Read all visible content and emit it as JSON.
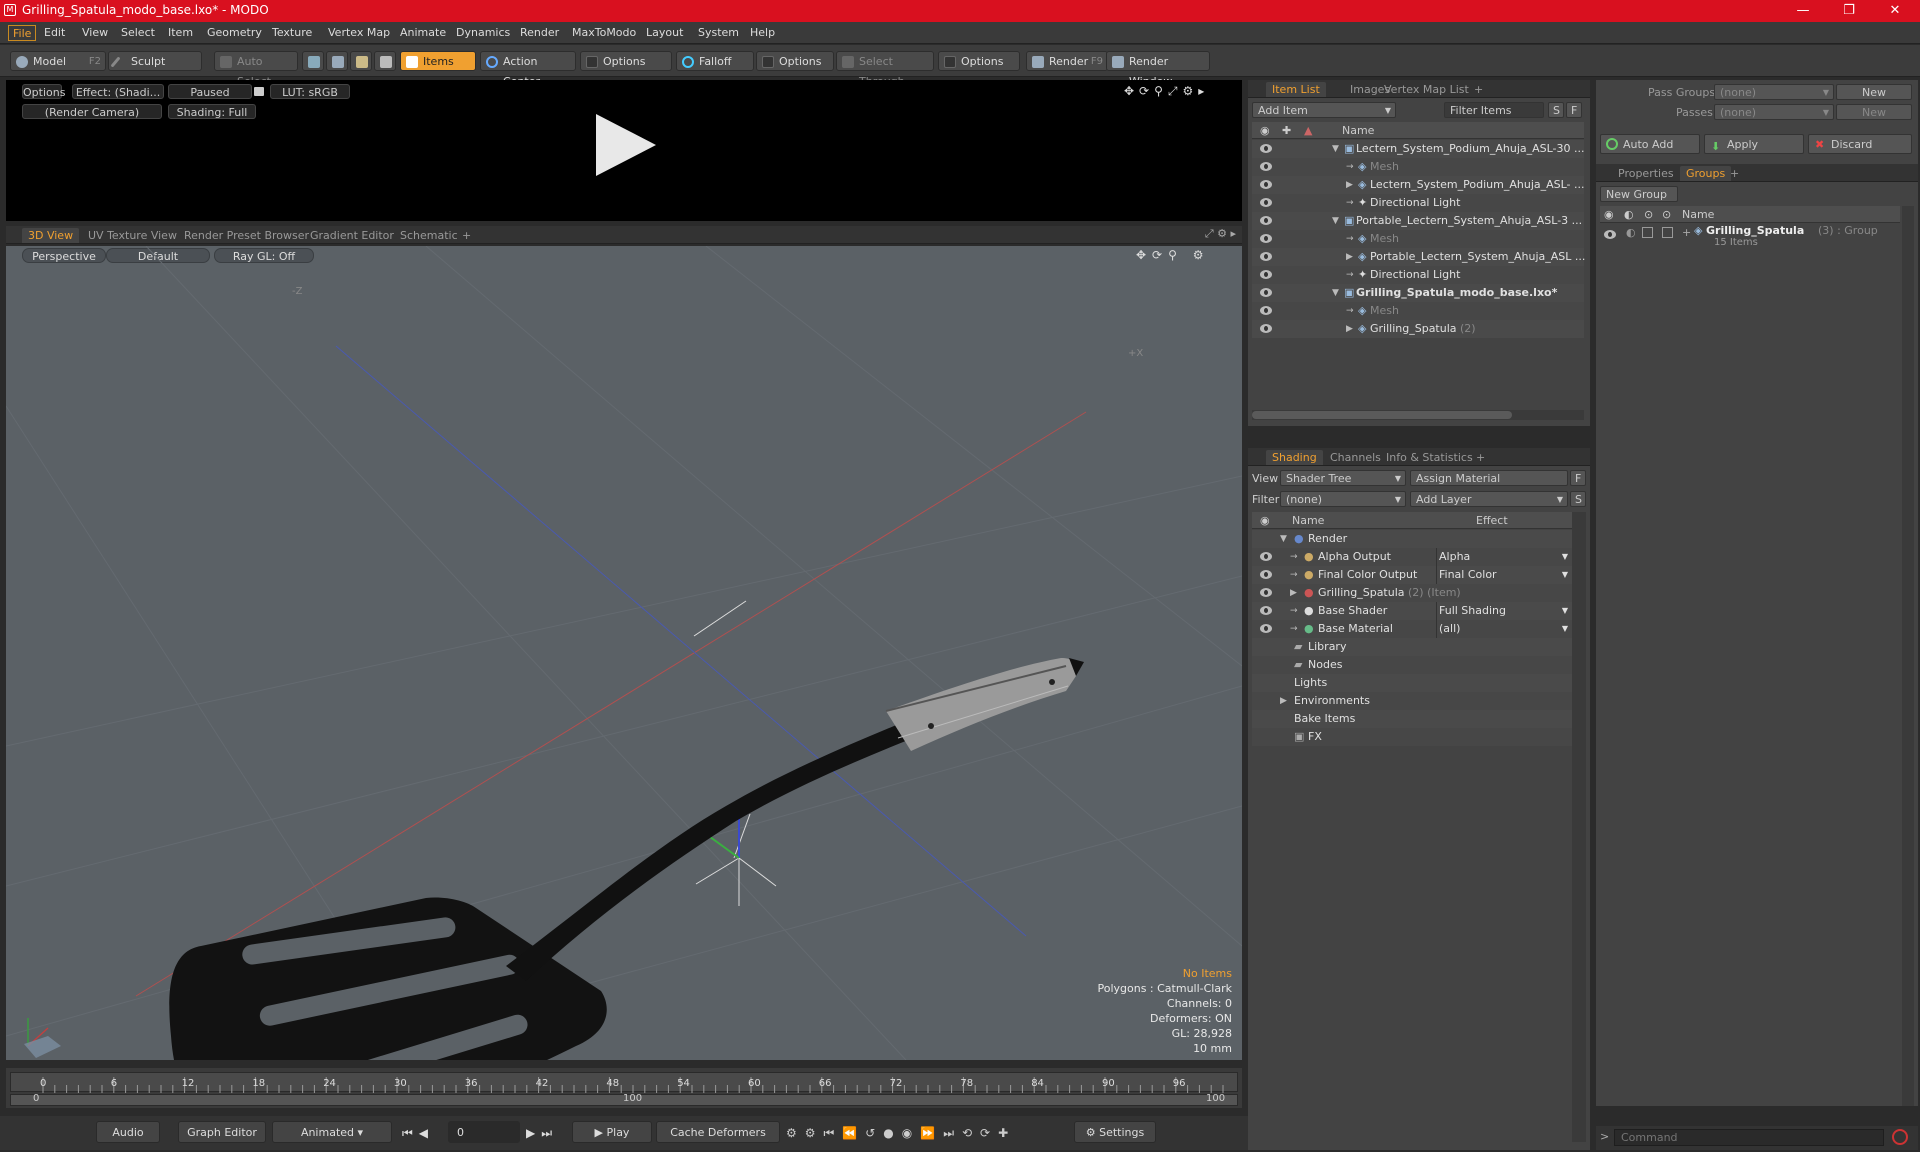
{
  "window": {
    "title": "Grilling_Spatula_modo_base.lxo* - MODO",
    "minimize": "—",
    "maximize": "❐",
    "close": "✕"
  },
  "menu": [
    "File",
    "Edit",
    "View",
    "Select",
    "Item",
    "Geometry",
    "Texture",
    "Vertex Map",
    "Animate",
    "Dynamics",
    "Render",
    "MaxToModo",
    "Layout",
    "System",
    "Help"
  ],
  "toolbar": {
    "model": "Model",
    "model_key": "F2",
    "sculpt": "Sculpt",
    "auto_select": "Auto Select",
    "items": "Items",
    "action_center": "Action Center",
    "options1": "Options",
    "falloff": "Falloff",
    "options2": "Options",
    "select_through": "Select Through",
    "options3": "Options",
    "render": "Render",
    "render_key": "F9",
    "render_window": "Render Window"
  },
  "preview": {
    "options": "Options",
    "effect": "Effect: (Shadi...",
    "paused": "Paused",
    "lut": "LUT: sRGB",
    "camera": "(Render Camera)",
    "shading": "Shading: Full"
  },
  "viewport_tabs": [
    "3D View",
    "UV Texture View",
    "Render Preset Browser",
    "Gradient Editor",
    "Schematic",
    "+"
  ],
  "viewport": {
    "perspective": "Perspective",
    "default": "Default",
    "raygl": "Ray GL: Off",
    "axis_z": "-Z",
    "axis_x": "+X",
    "stats": {
      "no_items": "No Items",
      "polygons": "Polygons : Catmull-Clark",
      "channels": "Channels: 0",
      "deformers": "Deformers: ON",
      "gl": "GL: 28,928",
      "scale": "10 mm"
    }
  },
  "timeline": {
    "ticks": [
      "0",
      "6",
      "12",
      "18",
      "24",
      "30",
      "36",
      "42",
      "48",
      "54",
      "60",
      "66",
      "72",
      "78",
      "84",
      "90",
      "96"
    ],
    "sub_start": "0",
    "sub_mid": "100",
    "sub_end": "100"
  },
  "bottom": {
    "audio": "Audio",
    "graph_editor": "Graph Editor",
    "animated": "Animated",
    "frame": "0",
    "play": "Play",
    "cache": "Cache Deformers",
    "settings": "Settings"
  },
  "item_list": {
    "tabs": [
      "Item List",
      "Images",
      "Vertex Map List",
      "+"
    ],
    "add_item": "Add Item",
    "filter_items": "Filter Items",
    "s": "S",
    "f": "F",
    "col_name": "Name",
    "rows": [
      {
        "text": "Lectern_System_Podium_Ahuja_ASL-30 ...",
        "indent": 0,
        "expanded": true,
        "icon": "scene"
      },
      {
        "text": "Mesh",
        "indent": 1,
        "dim": true,
        "icon": "mesh"
      },
      {
        "text": "Lectern_System_Podium_Ahuja_ASL- ...",
        "indent": 1,
        "collapsed": true,
        "icon": "mesh"
      },
      {
        "text": "Directional Light",
        "indent": 1,
        "icon": "light"
      },
      {
        "text": "Portable_Lectern_System_Ahuja_ASL-3 ...",
        "indent": 0,
        "expanded": true,
        "icon": "scene"
      },
      {
        "text": "Mesh",
        "indent": 1,
        "dim": true,
        "icon": "mesh"
      },
      {
        "text": "Portable_Lectern_System_Ahuja_ASL ...",
        "indent": 1,
        "collapsed": true,
        "icon": "mesh"
      },
      {
        "text": "Directional Light",
        "indent": 1,
        "icon": "light"
      },
      {
        "text": "Grilling_Spatula_modo_base.lxo*",
        "indent": 0,
        "expanded": true,
        "bold": true,
        "icon": "scene"
      },
      {
        "text": "Mesh",
        "indent": 1,
        "dim": true,
        "icon": "mesh"
      },
      {
        "text": "Grilling_Spatula",
        "suffix": "(2)",
        "indent": 1,
        "collapsed": true,
        "icon": "mesh"
      }
    ]
  },
  "shading": {
    "tabs": [
      "Shading",
      "Channels",
      "Info & Statistics",
      "+"
    ],
    "view_label": "View",
    "view_value": "Shader Tree",
    "assign_material": "Assign Material",
    "f": "F",
    "filter_label": "Filter",
    "filter_value": "(none)",
    "add_layer": "Add Layer",
    "s": "S",
    "col_name": "Name",
    "col_effect": "Effect",
    "rows": [
      {
        "name": "Render",
        "effect": "",
        "indent": 0,
        "expanded": true,
        "eye": false,
        "icon": "render"
      },
      {
        "name": "Alpha Output",
        "effect": "Alpha",
        "indent": 1,
        "eye": true,
        "icon": "output"
      },
      {
        "name": "Final Color Output",
        "effect": "Final Color",
        "indent": 1,
        "eye": true,
        "icon": "output"
      },
      {
        "name": "Grilling_Spatula",
        "suffix": "(2) (Item)",
        "effect": "",
        "indent": 1,
        "collapsed": true,
        "eye": true,
        "icon": "mask"
      },
      {
        "name": "Base Shader",
        "effect": "Full Shading",
        "indent": 1,
        "eye": true,
        "icon": "shader"
      },
      {
        "name": "Base Material",
        "effect": "(all)",
        "indent": 1,
        "eye": true,
        "icon": "material"
      },
      {
        "name": "Library",
        "effect": "",
        "indent": 0,
        "icon": "folder"
      },
      {
        "name": "Nodes",
        "effect": "",
        "indent": 0,
        "icon": "folder"
      },
      {
        "name": "Lights",
        "effect": "",
        "indent": 0,
        "icon": "none"
      },
      {
        "name": "Environments",
        "effect": "",
        "indent": 0,
        "collapsed": true,
        "icon": "none"
      },
      {
        "name": "Bake Items",
        "effect": "",
        "indent": 0,
        "icon": "none"
      },
      {
        "name": "FX",
        "effect": "",
        "indent": 0,
        "icon": "fx"
      }
    ]
  },
  "groups_panel": {
    "pass_groups": "Pass Groups",
    "pass_groups_val": "(none)",
    "new": "New",
    "passes": "Passes",
    "passes_val": "(none)",
    "new2": "New",
    "auto_add": "Auto Add",
    "apply": "Apply",
    "discard": "Discard",
    "tabs": [
      "Properties",
      "Groups",
      "+"
    ],
    "new_group": "New Group",
    "col_name": "Name",
    "group_name": "Grilling_Spatula",
    "group_suffix": "(3) : Group",
    "group_count": "15 Items"
  },
  "command": {
    "placeholder": "Command"
  },
  "colors": {
    "accent": "#f0a030",
    "titlebar": "#d9101f",
    "viewport_bg": "#5b6166"
  }
}
